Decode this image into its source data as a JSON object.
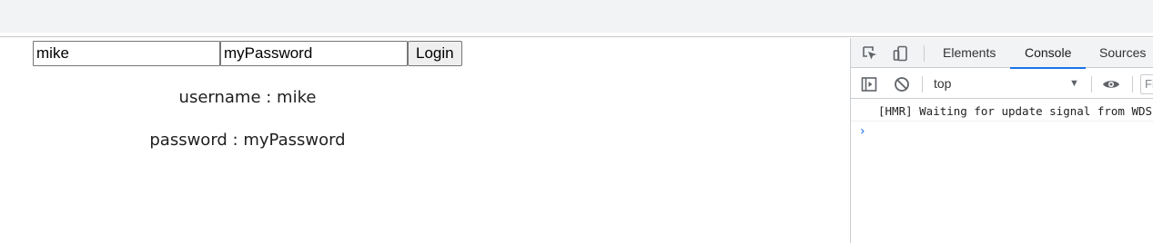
{
  "login_form": {
    "username_value": "mike",
    "password_value": "myPassword",
    "login_label": "Login"
  },
  "output": {
    "username_line": "username : mike",
    "password_line": "password : myPassword"
  },
  "devtools": {
    "tabs": [
      "Elements",
      "Console",
      "Sources"
    ],
    "active_tab": "Console",
    "context": "top",
    "filter_placeholder": "Fi",
    "messages": [
      "[HMR] Waiting for update signal from WDS..."
    ],
    "accent_color": "#1a73e8"
  }
}
